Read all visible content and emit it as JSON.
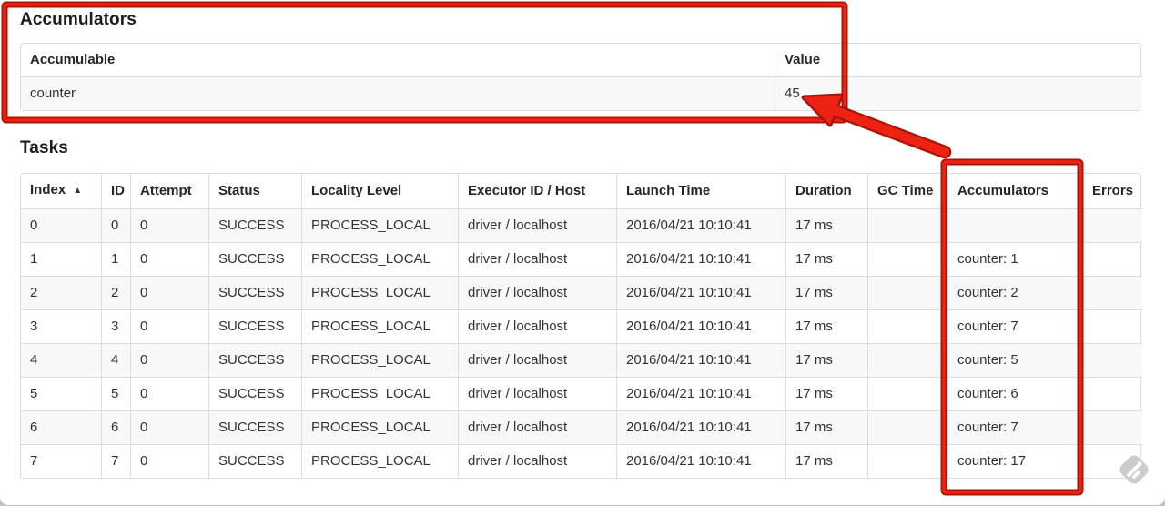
{
  "accumulators_section": {
    "title": "Accumulators",
    "table": {
      "columns": [
        {
          "key": "accumulable",
          "label": "Accumulable",
          "sortable": false
        },
        {
          "key": "value",
          "label": "Value",
          "sortable": false
        }
      ],
      "rows": [
        {
          "accumulable": "counter",
          "value": "45"
        }
      ]
    }
  },
  "tasks_section": {
    "title": "Tasks",
    "table": {
      "columns": [
        {
          "key": "index",
          "label": "Index",
          "sortable": true,
          "sorted_ascending": true,
          "sort_indicator": "▲"
        },
        {
          "key": "id",
          "label": "ID",
          "sortable": true
        },
        {
          "key": "attempt",
          "label": "Attempt",
          "sortable": true
        },
        {
          "key": "status",
          "label": "Status",
          "sortable": true
        },
        {
          "key": "locality_level",
          "label": "Locality Level",
          "sortable": true
        },
        {
          "key": "executor_id_host",
          "label": "Executor ID / Host",
          "sortable": true
        },
        {
          "key": "launch_time",
          "label": "Launch Time",
          "sortable": true
        },
        {
          "key": "duration",
          "label": "Duration",
          "sortable": true
        },
        {
          "key": "gc_time",
          "label": "GC Time",
          "sortable": true
        },
        {
          "key": "accumulators",
          "label": "Accumulators",
          "sortable": true
        },
        {
          "key": "errors",
          "label": "Errors",
          "sortable": true
        }
      ],
      "rows": [
        {
          "index": "0",
          "id": "0",
          "attempt": "0",
          "status": "SUCCESS",
          "locality_level": "PROCESS_LOCAL",
          "executor_id_host": "driver / localhost",
          "launch_time": "2016/04/21 10:10:41",
          "duration": "17 ms",
          "gc_time": "",
          "accumulators": "",
          "errors": ""
        },
        {
          "index": "1",
          "id": "1",
          "attempt": "0",
          "status": "SUCCESS",
          "locality_level": "PROCESS_LOCAL",
          "executor_id_host": "driver / localhost",
          "launch_time": "2016/04/21 10:10:41",
          "duration": "17 ms",
          "gc_time": "",
          "accumulators": "counter: 1",
          "errors": ""
        },
        {
          "index": "2",
          "id": "2",
          "attempt": "0",
          "status": "SUCCESS",
          "locality_level": "PROCESS_LOCAL",
          "executor_id_host": "driver / localhost",
          "launch_time": "2016/04/21 10:10:41",
          "duration": "17 ms",
          "gc_time": "",
          "accumulators": "counter: 2",
          "errors": ""
        },
        {
          "index": "3",
          "id": "3",
          "attempt": "0",
          "status": "SUCCESS",
          "locality_level": "PROCESS_LOCAL",
          "executor_id_host": "driver / localhost",
          "launch_time": "2016/04/21 10:10:41",
          "duration": "17 ms",
          "gc_time": "",
          "accumulators": "counter: 7",
          "errors": ""
        },
        {
          "index": "4",
          "id": "4",
          "attempt": "0",
          "status": "SUCCESS",
          "locality_level": "PROCESS_LOCAL",
          "executor_id_host": "driver / localhost",
          "launch_time": "2016/04/21 10:10:41",
          "duration": "17 ms",
          "gc_time": "",
          "accumulators": "counter: 5",
          "errors": ""
        },
        {
          "index": "5",
          "id": "5",
          "attempt": "0",
          "status": "SUCCESS",
          "locality_level": "PROCESS_LOCAL",
          "executor_id_host": "driver / localhost",
          "launch_time": "2016/04/21 10:10:41",
          "duration": "17 ms",
          "gc_time": "",
          "accumulators": "counter: 6",
          "errors": ""
        },
        {
          "index": "6",
          "id": "6",
          "attempt": "0",
          "status": "SUCCESS",
          "locality_level": "PROCESS_LOCAL",
          "executor_id_host": "driver / localhost",
          "launch_time": "2016/04/21 10:10:41",
          "duration": "17 ms",
          "gc_time": "",
          "accumulators": "counter: 7",
          "errors": ""
        },
        {
          "index": "7",
          "id": "7",
          "attempt": "0",
          "status": "SUCCESS",
          "locality_level": "PROCESS_LOCAL",
          "executor_id_host": "driver / localhost",
          "launch_time": "2016/04/21 10:10:41",
          "duration": "17 ms",
          "gc_time": "",
          "accumulators": "counter: 17",
          "errors": ""
        }
      ]
    }
  },
  "annotations": {
    "accent_color": "#ee2213",
    "accent_edge_color": "#a81508",
    "items": [
      {
        "type": "rectangle",
        "target": "accumulators-section"
      },
      {
        "type": "rectangle",
        "target": "tasks-accumulators-column"
      },
      {
        "type": "arrow",
        "from": "tasks-accumulators-column",
        "to": "accumulator-value-45"
      }
    ]
  },
  "colors": {
    "table_border": "#dddddd",
    "row_stripe": "#f8f8f8",
    "cell_text": "#333333",
    "watermark_gray": "#cccccc"
  },
  "watermark": {
    "name": "feedly-logo"
  }
}
